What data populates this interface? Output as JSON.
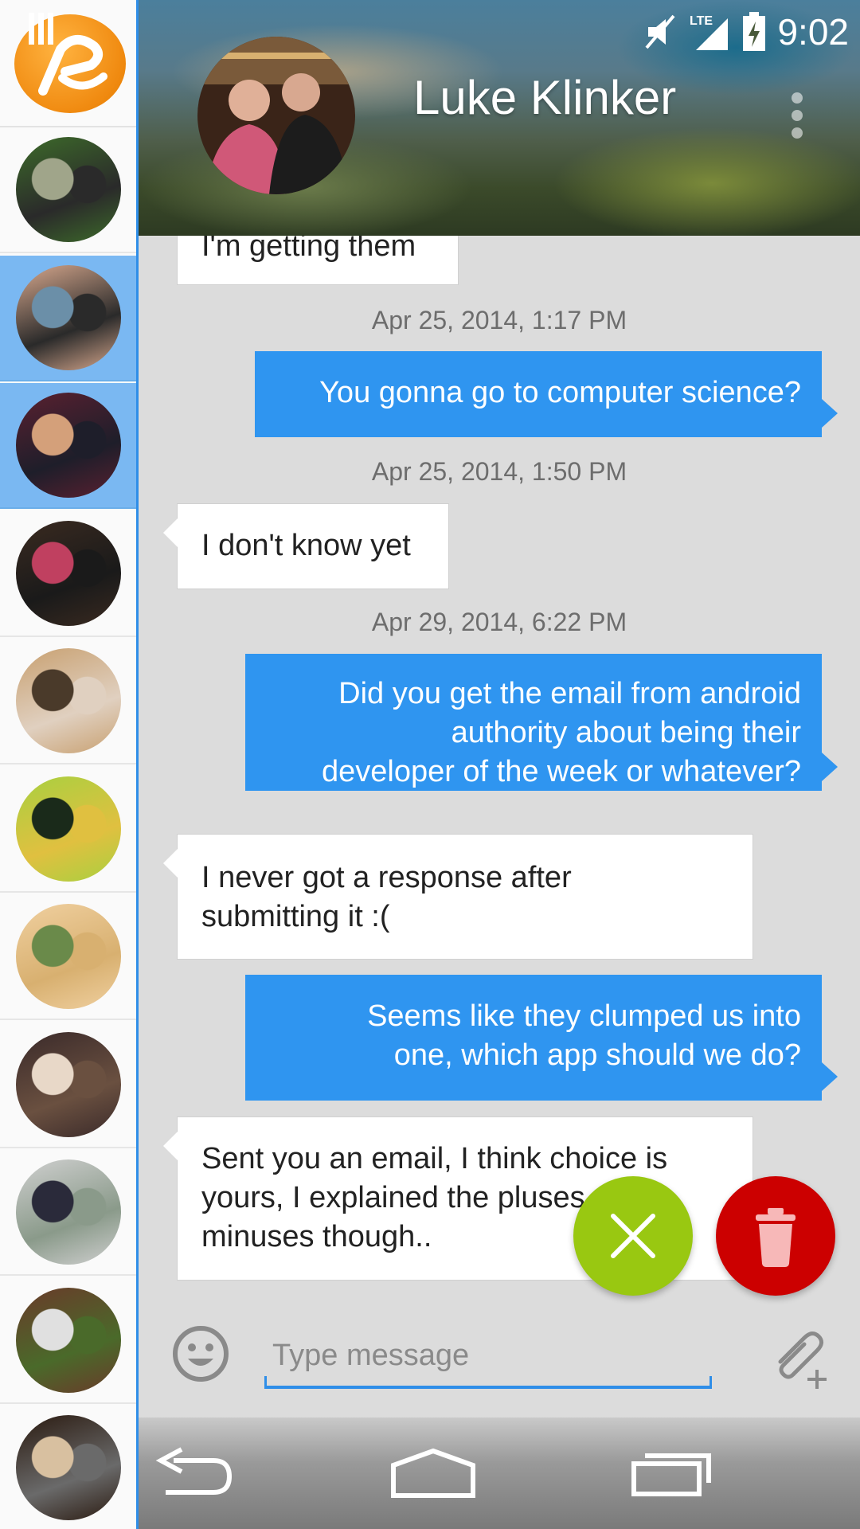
{
  "status_bar": {
    "time": "9:02",
    "network": "LTE",
    "icons": [
      "mute-icon",
      "signal-icon",
      "battery-charging-icon"
    ]
  },
  "conversation": {
    "contact_name": "Luke Klinker"
  },
  "sidebar": {
    "contacts": [
      {
        "id": "contact-1",
        "colors": [
          "#3d6b2a",
          "#a0a58a",
          "#2a2a2a"
        ],
        "selected": false
      },
      {
        "id": "contact-2",
        "colors": [
          "#d9a98e",
          "#6b8fa8",
          "#2a2a2a"
        ],
        "selected": true
      },
      {
        "id": "contact-3",
        "colors": [
          "#5a2030",
          "#d4a07a",
          "#1e1e2a"
        ],
        "selected": true
      },
      {
        "id": "contact-4",
        "colors": [
          "#3a2a20",
          "#c04060",
          "#1a1a1a"
        ],
        "selected": false
      },
      {
        "id": "contact-5",
        "colors": [
          "#c8a070",
          "#4a3a2a",
          "#e0d0c0"
        ],
        "selected": false
      },
      {
        "id": "contact-6",
        "colors": [
          "#a8d040",
          "#1a2a1a",
          "#e0c040"
        ],
        "selected": false
      },
      {
        "id": "contact-7",
        "colors": [
          "#f0d0a0",
          "#6a8a4a",
          "#d8b070"
        ],
        "selected": false
      },
      {
        "id": "contact-8",
        "colors": [
          "#3a2a2a",
          "#e8d8c8",
          "#6a5040"
        ],
        "selected": false
      },
      {
        "id": "contact-9",
        "colors": [
          "#d0d0d0",
          "#2a2a3a",
          "#8a9a8a"
        ],
        "selected": false
      },
      {
        "id": "contact-10",
        "colors": [
          "#6a3a2a",
          "#e0e0e0",
          "#4a6a2a"
        ],
        "selected": false
      },
      {
        "id": "contact-11",
        "colors": [
          "#2a1a10",
          "#d8c0a0",
          "#6a6a6a"
        ],
        "selected": false
      }
    ]
  },
  "messages": [
    {
      "type": "in",
      "text": "I'm getting them"
    },
    {
      "type": "timestamp",
      "text": "Apr 25, 2014, 1:17 PM"
    },
    {
      "type": "out",
      "text": "You gonna go to computer science?"
    },
    {
      "type": "timestamp",
      "text": "Apr 25, 2014, 1:50 PM"
    },
    {
      "type": "in",
      "text": "I don't know yet"
    },
    {
      "type": "timestamp",
      "text": "Apr 29, 2014, 6:22 PM"
    },
    {
      "type": "out",
      "lines": [
        "Did you get the email from android",
        "authority about being their",
        "developer of the week or whatever?"
      ]
    },
    {
      "type": "in",
      "lines": [
        "I never got a response after",
        "submitting it :("
      ]
    },
    {
      "type": "out",
      "lines": [
        "Seems like they clumped us into",
        "one, which app should we do?"
      ]
    },
    {
      "type": "in",
      "lines": [
        "Sent you an email, I think choice is",
        "yours, I explained the pluses and",
        "minuses though.."
      ]
    }
  ],
  "composer": {
    "placeholder": "Type message",
    "value": ""
  },
  "actions": {
    "cancel_color": "#99c811",
    "delete_color": "#cc0000"
  },
  "theme": {
    "accent": "#2f8ee8",
    "outgoing_bubble": "#2f95f0",
    "incoming_bubble": "#ffffff"
  }
}
